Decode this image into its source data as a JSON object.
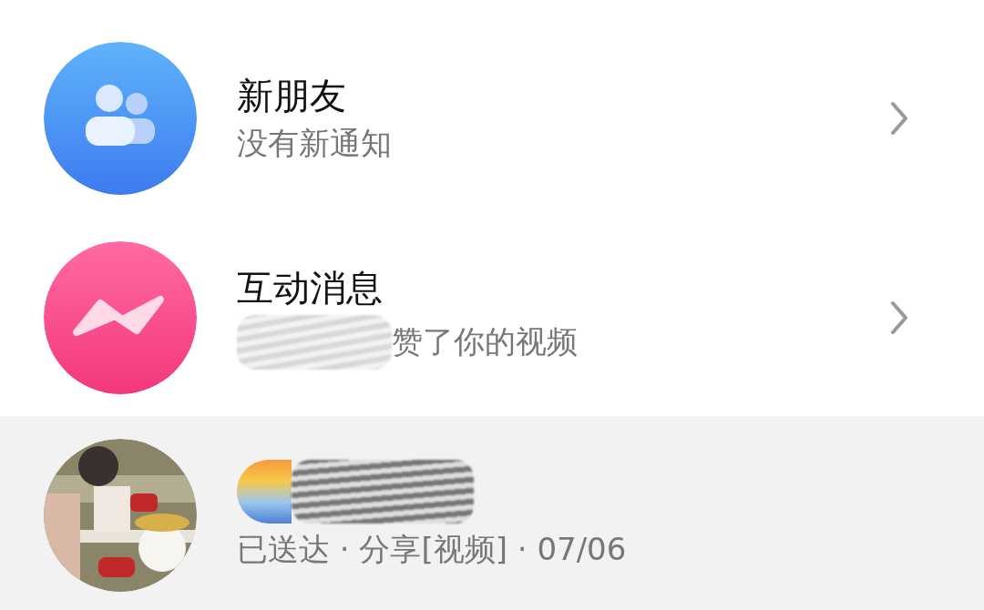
{
  "rows": [
    {
      "kind": "friends",
      "title": "新朋友",
      "subtitle": "没有新通知",
      "redacted_title": false,
      "redacted_subtitle": false,
      "chevron": true,
      "selected": false
    },
    {
      "kind": "interactions",
      "title": "互动消息",
      "subtitle": "赞了你的视频",
      "redacted_title": false,
      "redacted_subtitle": true,
      "chevron": true,
      "selected": false
    },
    {
      "kind": "picture",
      "subtitle": "已送达 · 分享[视频] · 07/06",
      "redacted_title": true,
      "redacted_subtitle": false,
      "chevron": false,
      "selected": true
    }
  ]
}
